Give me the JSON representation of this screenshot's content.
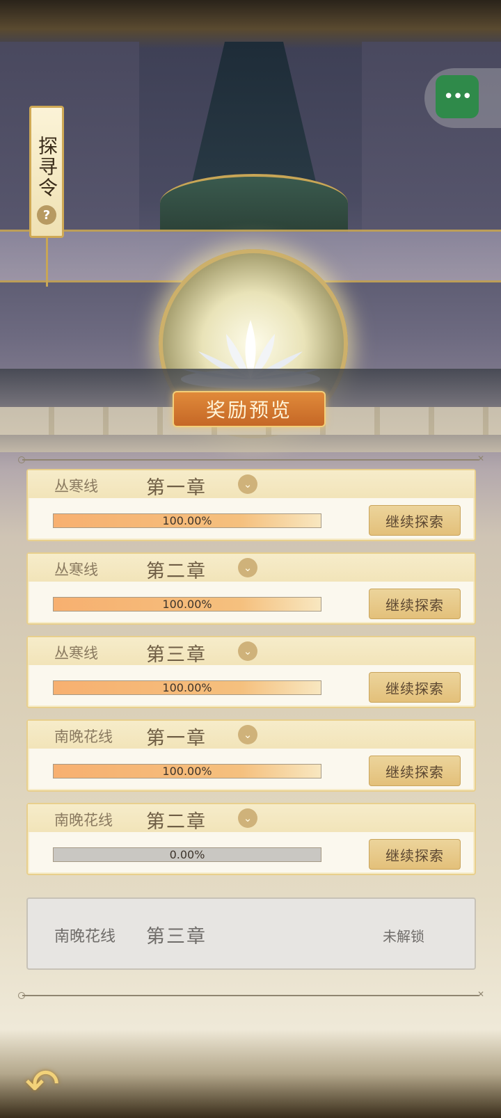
{
  "header": {
    "tag_title": "探寻令",
    "help_glyph": "?",
    "menu_glyph": "•••"
  },
  "banner": {
    "title": "奖励预览"
  },
  "chapters": [
    {
      "line": "丛寒线",
      "chapter": "第一章",
      "progress_pct": 100.0,
      "progress_text": "100.00%",
      "button": "继续探索",
      "expand_icon": "chevron-down-icon"
    },
    {
      "line": "丛寒线",
      "chapter": "第二章",
      "progress_pct": 100.0,
      "progress_text": "100.00%",
      "button": "继续探索",
      "expand_icon": "chevron-down-icon"
    },
    {
      "line": "丛寒线",
      "chapter": "第三章",
      "progress_pct": 100.0,
      "progress_text": "100.00%",
      "button": "继续探索",
      "expand_icon": "chevron-down-icon"
    },
    {
      "line": "南晚花线",
      "chapter": "第一章",
      "progress_pct": 100.0,
      "progress_text": "100.00%",
      "button": "继续探索",
      "expand_icon": "chevron-down-icon"
    },
    {
      "line": "南晚花线",
      "chapter": "第二章",
      "progress_pct": 0.0,
      "progress_text": "0.00%",
      "button": "继续探索",
      "expand_icon": "chevron-down-icon"
    }
  ],
  "locked_chapter": {
    "line": "南晚花线",
    "chapter": "第三章",
    "status": "未解锁"
  },
  "footer": {
    "back_icon": "back-arrow-icon"
  },
  "colors": {
    "accent_gold": "#e8cf8c",
    "progress_orange": "#f7b070",
    "button_gold": "#e3c07a",
    "menu_green": "#2f8a4a"
  }
}
